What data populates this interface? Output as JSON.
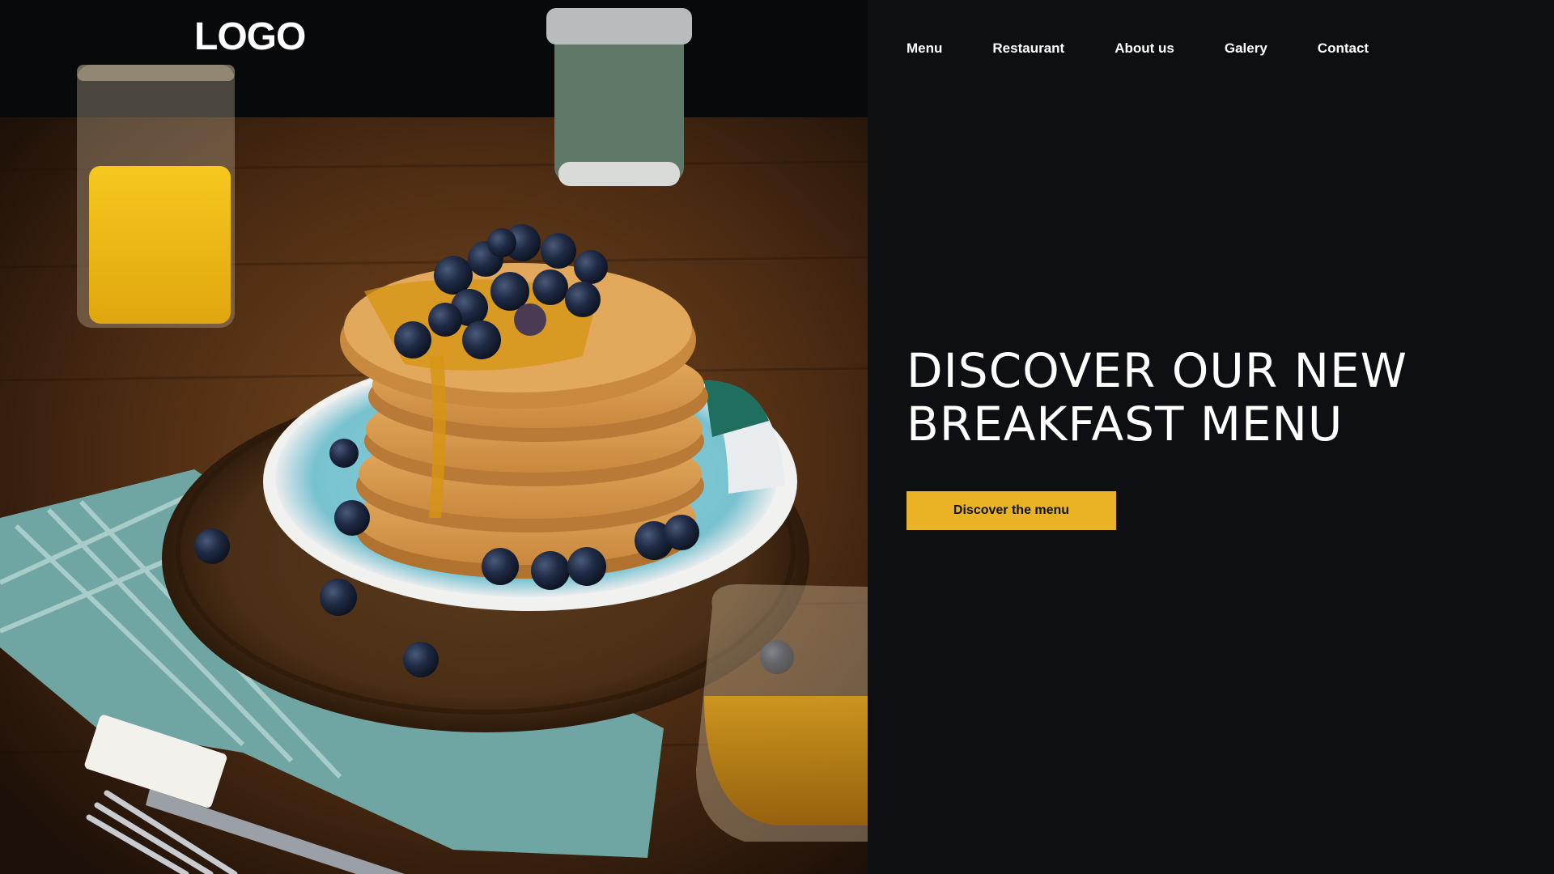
{
  "brand": {
    "logo_text": "LOGO"
  },
  "nav": {
    "items": [
      {
        "label": "Menu"
      },
      {
        "label": "Restaurant"
      },
      {
        "label": "About us"
      },
      {
        "label": "Galery"
      },
      {
        "label": "Contact"
      }
    ]
  },
  "hero": {
    "headline_line1": "DISCOVER OUR NEW",
    "headline_line2": "BREAKFAST MENU",
    "cta_label": "Discover the menu",
    "photo_subject": "pancake-stack-with-blueberries-and-syrup"
  },
  "colors": {
    "background": "#0e0f13",
    "accent": "#e9b325",
    "text": "#ffffff"
  }
}
